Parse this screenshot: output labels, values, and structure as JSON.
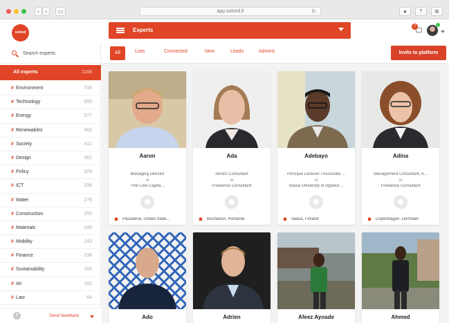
{
  "browser": {
    "url": "app.solved.fi",
    "buttons": {
      "back": "‹",
      "forward": "›",
      "sidebar": "▭"
    }
  },
  "app": {
    "logo_text": "solved",
    "section_title": "Experts",
    "notification_count": "2"
  },
  "sidebar": {
    "search_placeholder": "Search experts",
    "active": {
      "label": "All experts",
      "count": "1168"
    },
    "categories": [
      {
        "label": "Environment",
        "count": "708"
      },
      {
        "label": "Technology",
        "count": "600"
      },
      {
        "label": "Energy",
        "count": "577"
      },
      {
        "label": "Renewables",
        "count": "462"
      },
      {
        "label": "Society",
        "count": "412"
      },
      {
        "label": "Design",
        "count": "361"
      },
      {
        "label": "Policy",
        "count": "329"
      },
      {
        "label": "ICT",
        "count": "296"
      },
      {
        "label": "Water",
        "count": "279"
      },
      {
        "label": "Construction",
        "count": "255"
      },
      {
        "label": "Materials",
        "count": "245"
      },
      {
        "label": "Mobility",
        "count": "243"
      },
      {
        "label": "Finance",
        "count": "238"
      },
      {
        "label": "Sustainability",
        "count": "165"
      },
      {
        "label": "Air",
        "count": "162"
      },
      {
        "label": "Law",
        "count": "64"
      }
    ],
    "help_label": "?",
    "feedback_label": "Send feedback"
  },
  "tabs": [
    "All",
    "Lists",
    "Connected",
    "New",
    "Leads",
    "Admins"
  ],
  "invite_label": "Invite to platform",
  "experts": [
    {
      "name": "Aaron",
      "role": "Managing Director",
      "at": "at",
      "org": "Thin Line Capita...",
      "location": "Pasadena, United State..."
    },
    {
      "name": "Ada",
      "role": "Senior Consultant",
      "at": "at",
      "org": "Freelance Consultant",
      "location": "Bucharest, Romania"
    },
    {
      "name": "Adebayo",
      "role": "Principal Lecturer / Associate ...",
      "at": "at",
      "org": "Vaasa University of Applied ...",
      "location": "Vaasa, Finland"
    },
    {
      "name": "Adina",
      "role": "Management Consultant, A...",
      "at": "at",
      "org": "Freelance Consultant",
      "location": "Copenhagen, Denmark"
    },
    {
      "name": "Ado"
    },
    {
      "name": "Adrien"
    },
    {
      "name": "Afeez Ayoade"
    },
    {
      "name": "Ahmed"
    }
  ],
  "colors": {
    "accent": "#e04527",
    "sidebar_active": "#e04527",
    "background": "#f3f3f3"
  }
}
